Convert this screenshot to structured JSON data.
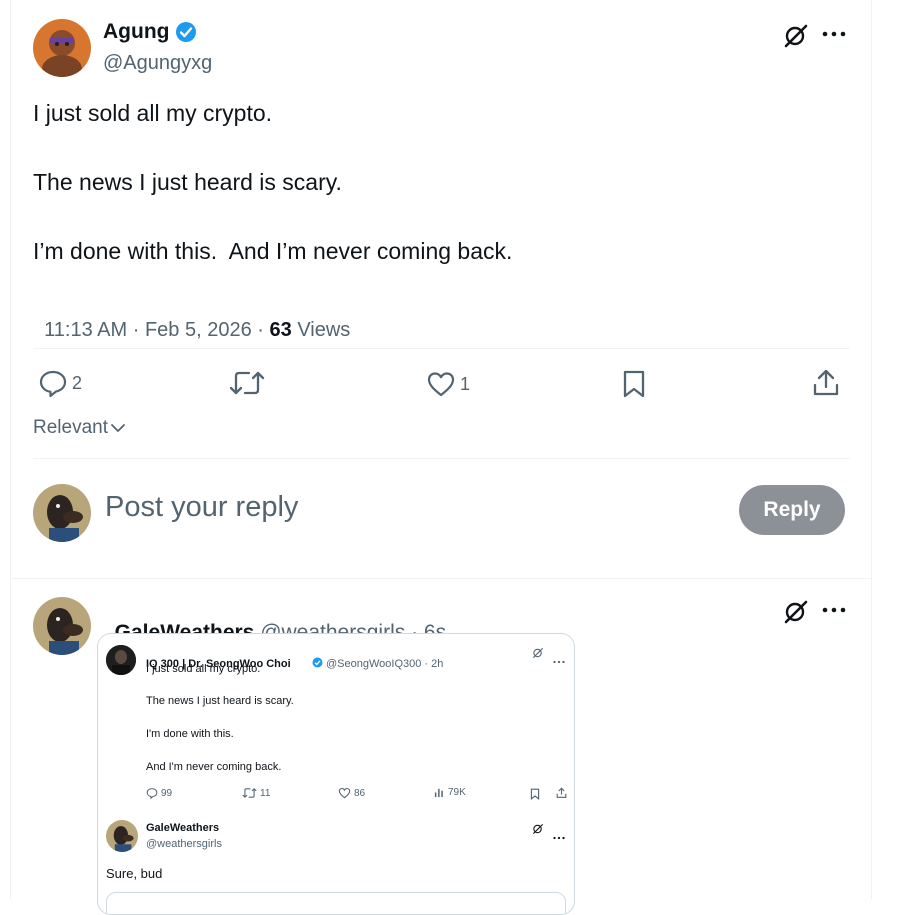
{
  "post": {
    "author_name": "Agung",
    "author_handle": "@Agungyxg",
    "lines": [
      "I just sold all my crypto.",
      "The news I just heard is scary.",
      "I’m done with this.  And I’m never coming back."
    ],
    "time": "11:13 AM",
    "date": "Feb 5, 2026",
    "views_count": "63",
    "views_label": "Views",
    "sep": "·"
  },
  "actions": {
    "replies": "2",
    "likes": "1"
  },
  "sort": {
    "label": "Relevant"
  },
  "composer": {
    "placeholder": "Post your reply",
    "button": "Reply"
  },
  "reply": {
    "author_name": "GaleWeathers",
    "author_handle": "@weathersgirls",
    "time": "· 6s"
  },
  "quoted": {
    "author_name": "IQ 300 | Dr. SeongWoo Choi",
    "author_handle": "@SeongWooIQ300",
    "time": "· 2h",
    "lines": [
      "I just sold all my crypto.",
      "The news I just heard is scary.",
      "I'm done with this.",
      "And I'm never coming back."
    ],
    "replies": "99",
    "reposts": "11",
    "likes": "86",
    "views": "79K",
    "reply_author_name": "GaleWeathers",
    "reply_author_handle": "@weathersgirls",
    "reply_text": "Sure, bud"
  },
  "colors": {
    "verified": "#1d9bf0",
    "muted": "#536471",
    "reply_button": "#8b9196"
  }
}
